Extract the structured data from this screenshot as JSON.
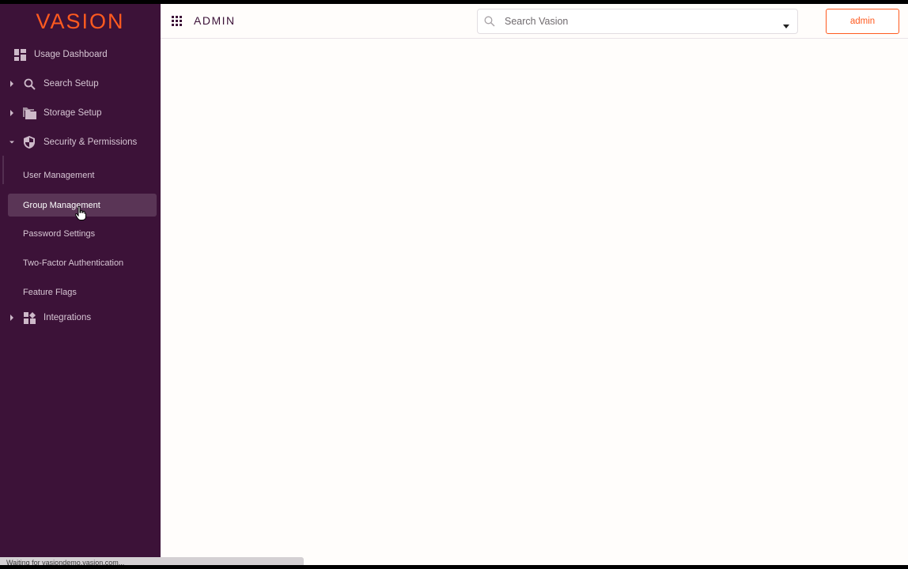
{
  "brand": {
    "logo_text": "VASION",
    "accent": "#ff5a1f",
    "sidebar_bg": "#3c1238"
  },
  "header": {
    "apps_icon": "apps-grid-icon",
    "title": "ADMIN",
    "search": {
      "placeholder": "Search Vasion",
      "icon": "search-icon"
    },
    "user_button": "admin"
  },
  "sidebar": {
    "items": [
      {
        "label": "Usage Dashboard",
        "icon": "dashboard-icon"
      },
      {
        "label": "Search Setup",
        "icon": "search-icon",
        "expanded": false
      },
      {
        "label": "Storage Setup",
        "icon": "folder-icon",
        "expanded": false
      },
      {
        "label": "Security & Permissions",
        "icon": "shield-icon",
        "expanded": true
      },
      {
        "label": "Integrations",
        "icon": "widgets-icon",
        "expanded": false
      }
    ],
    "security_children": [
      {
        "label": "User Management"
      },
      {
        "label": "Group Management",
        "active": true
      },
      {
        "label": "Password Settings"
      },
      {
        "label": "Two-Factor Authentication"
      },
      {
        "label": "Feature Flags"
      }
    ]
  },
  "status": {
    "text": "Waiting for vasiondemo.vasion.com..."
  }
}
